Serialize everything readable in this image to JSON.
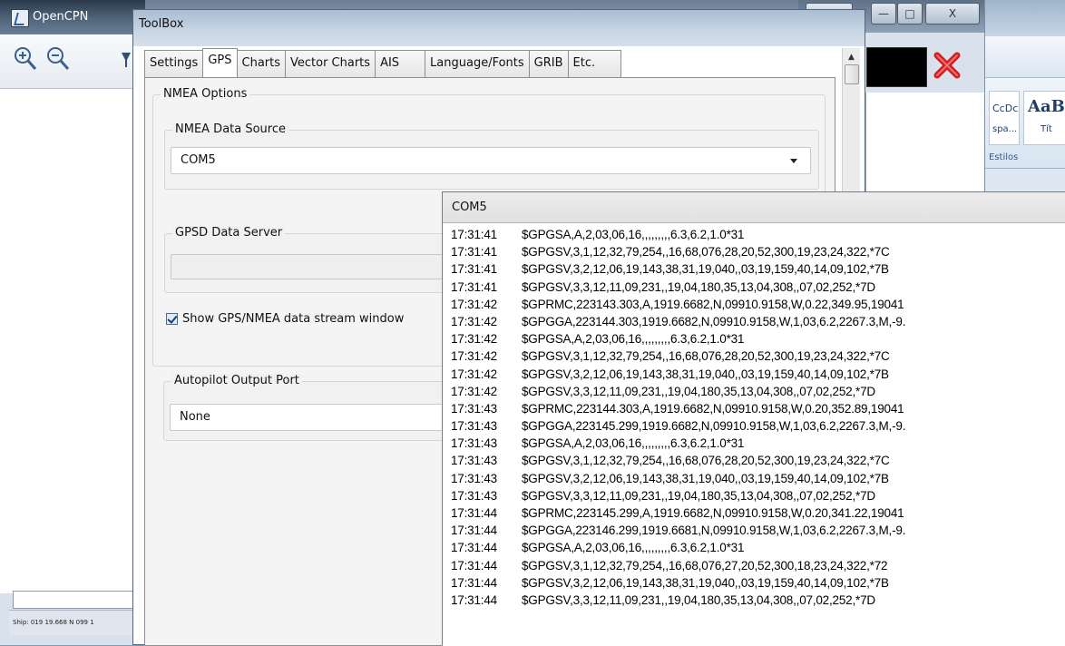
{
  "opencpn": {
    "title": "OpenCPN",
    "status_text": "Ship: 019 19.668 N  099 1"
  },
  "toolbox": {
    "title": "ToolBox",
    "tabs": [
      "Settings",
      "GPS",
      "Charts",
      "Vector Charts",
      "AIS",
      "Language/Fonts",
      "GRIB",
      "Etc."
    ],
    "active_tab": "GPS",
    "nmea_options_label": "NMEA Options",
    "nmea_source": {
      "label": "NMEA Data Source",
      "value": "COM5"
    },
    "gpsd": {
      "label": "GPSD Data Server",
      "value": ""
    },
    "show_stream": {
      "label": "Show GPS/NMEA data stream window",
      "checked": true
    },
    "autopilot": {
      "label": "Autopilot Output Port",
      "value": "None"
    },
    "close_label": "X"
  },
  "background_windows": {
    "min_label": "—",
    "max_label": "□",
    "close_label": "X"
  },
  "word": {
    "style1_sample": "CcDc",
    "style1_name": "spa...",
    "style2_sample": "AaB",
    "style2_name": "Tít",
    "group_label": "Estilos"
  },
  "com5": {
    "title": "COM5",
    "lines": [
      {
        "time": "17:31:41",
        "text": "$GPGSA,A,2,03,06,16,,,,,,,,,6.3,6.2,1.0*31"
      },
      {
        "time": "17:31:41",
        "text": "$GPGSV,3,1,12,32,79,254,,16,68,076,28,20,52,300,19,23,24,322,*7C"
      },
      {
        "time": "17:31:41",
        "text": "$GPGSV,3,2,12,06,19,143,38,31,19,040,,03,19,159,40,14,09,102,*7B"
      },
      {
        "time": "17:31:41",
        "text": "$GPGSV,3,3,12,11,09,231,,19,04,180,35,13,04,308,,07,02,252,*7D"
      },
      {
        "time": "17:31:42",
        "text": "$GPRMC,223143.303,A,1919.6682,N,09910.9158,W,0.22,349.95,19041"
      },
      {
        "time": "17:31:42",
        "text": "$GPGGA,223144.303,1919.6682,N,09910.9158,W,1,03,6.2,2267.3,M,-9."
      },
      {
        "time": "17:31:42",
        "text": "$GPGSA,A,2,03,06,16,,,,,,,,,6.3,6.2,1.0*31"
      },
      {
        "time": "17:31:42",
        "text": "$GPGSV,3,1,12,32,79,254,,16,68,076,28,20,52,300,19,23,24,322,*7C"
      },
      {
        "time": "17:31:42",
        "text": "$GPGSV,3,2,12,06,19,143,38,31,19,040,,03,19,159,40,14,09,102,*7B"
      },
      {
        "time": "17:31:42",
        "text": "$GPGSV,3,3,12,11,09,231,,19,04,180,35,13,04,308,,07,02,252,*7D"
      },
      {
        "time": "17:31:43",
        "text": "$GPRMC,223144.303,A,1919.6682,N,09910.9158,W,0.20,352.89,19041"
      },
      {
        "time": "17:31:43",
        "text": "$GPGGA,223145.299,1919.6682,N,09910.9158,W,1,03,6.2,2267.3,M,-9."
      },
      {
        "time": "17:31:43",
        "text": "$GPGSA,A,2,03,06,16,,,,,,,,,6.3,6.2,1.0*31"
      },
      {
        "time": "17:31:43",
        "text": "$GPGSV,3,1,12,32,79,254,,16,68,076,28,20,52,300,19,23,24,322,*7C"
      },
      {
        "time": "17:31:43",
        "text": "$GPGSV,3,2,12,06,19,143,38,31,19,040,,03,19,159,40,14,09,102,*7B"
      },
      {
        "time": "17:31:43",
        "text": "$GPGSV,3,3,12,11,09,231,,19,04,180,35,13,04,308,,07,02,252,*7D"
      },
      {
        "time": "17:31:44",
        "text": "$GPRMC,223145.299,A,1919.6682,N,09910.9158,W,0.20,341.22,19041"
      },
      {
        "time": "17:31:44",
        "text": "$GPGGA,223146.299,1919.6681,N,09910.9158,W,1,03,6.2,2267.3,M,-9."
      },
      {
        "time": "17:31:44",
        "text": "$GPGSA,A,2,03,06,16,,,,,,,,,6.3,6.2,1.0*31"
      },
      {
        "time": "17:31:44",
        "text": "$GPGSV,3,1,12,32,79,254,,16,68,076,27,20,52,300,18,23,24,322,*72"
      },
      {
        "time": "17:31:44",
        "text": "$GPGSV,3,2,12,06,19,143,38,31,19,040,,03,19,159,40,14,09,102,*7B"
      },
      {
        "time": "17:31:44",
        "text": "$GPGSV,3,3,12,11,09,231,,19,04,180,35,13,04,308,,07,02,252,*7D"
      }
    ]
  },
  "icons": {
    "zoom_in": "zoom-in-icon",
    "zoom_out": "zoom-out-icon",
    "stop": "red-x-icon",
    "app_logo": "opencpn-logo-icon"
  },
  "colors": {
    "accent_red": "#d21e1e",
    "title_bar_blue": "#a9bdd2"
  }
}
